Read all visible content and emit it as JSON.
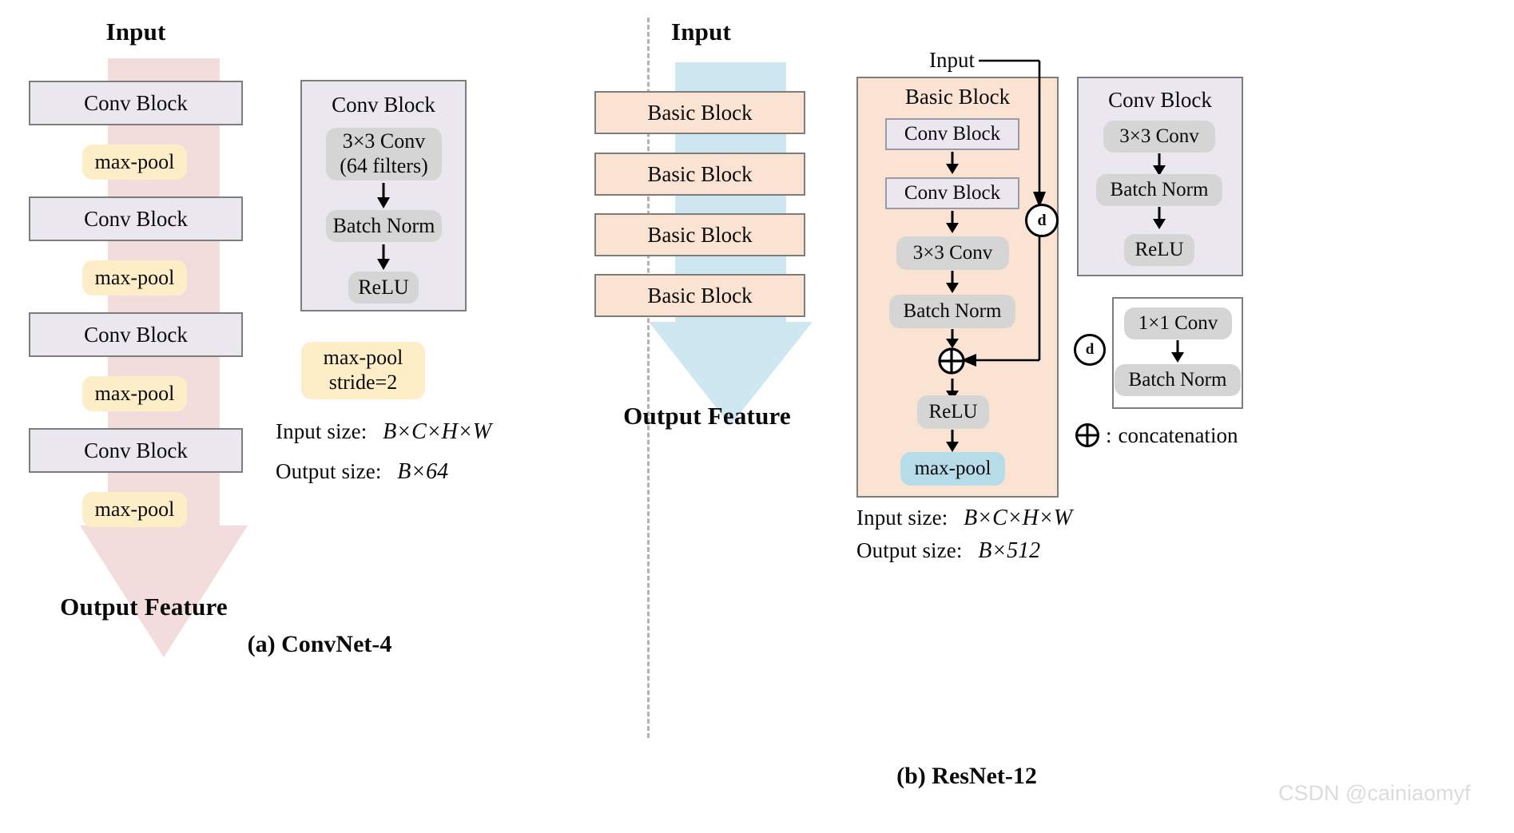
{
  "figure": {
    "watermark": "CSDN @cainiaomyf"
  },
  "panel_a": {
    "caption": "(a) ConvNet-4",
    "input_label": "Input",
    "output_label": "Output Feature",
    "flow_color": "#f2dcdc",
    "stack": [
      {
        "type": "conv-block",
        "label": "Conv Block"
      },
      {
        "type": "max-pool",
        "label": "max-pool"
      },
      {
        "type": "conv-block",
        "label": "Conv Block"
      },
      {
        "type": "max-pool",
        "label": "max-pool"
      },
      {
        "type": "conv-block",
        "label": "Conv Block"
      },
      {
        "type": "max-pool",
        "label": "max-pool"
      },
      {
        "type": "conv-block",
        "label": "Conv Block"
      },
      {
        "type": "max-pool",
        "label": "max-pool"
      }
    ],
    "conv_block_detail": {
      "title": "Conv Block",
      "steps": [
        {
          "label": "3×3  Conv",
          "label2": "(64 filters)"
        },
        {
          "label": "Batch Norm"
        },
        {
          "label": "ReLU"
        }
      ]
    },
    "maxpool_detail": {
      "line1": "max-pool",
      "line2": "stride=2"
    },
    "sizes": {
      "input_label": "Input size:",
      "input_value_parts": [
        "B",
        "×",
        "C",
        "×",
        "H",
        "×",
        "W"
      ],
      "input_value": "B×C×H×W",
      "output_label": "Output size:",
      "output_value": "B×64"
    }
  },
  "panel_b": {
    "caption": "(b) ResNet-12",
    "input_label": "Input",
    "output_label": "Output Feature",
    "flow_color": "#cfe7f0",
    "stack": [
      {
        "type": "basic-block",
        "label": "Basic Block"
      },
      {
        "type": "basic-block",
        "label": "Basic Block"
      },
      {
        "type": "basic-block",
        "label": "Basic Block"
      },
      {
        "type": "basic-block",
        "label": "Basic Block"
      }
    ],
    "basic_block_detail": {
      "skip_input_label": "Input",
      "title": "Basic Block",
      "downsample_symbol": "d",
      "concat_symbol": "⊕",
      "steps": [
        {
          "label": "Conv Block",
          "style": "rect-lav"
        },
        {
          "label": "Conv Block",
          "style": "rect-lav"
        },
        {
          "label": "3×3 Conv",
          "style": "pill-gray"
        },
        {
          "label": "Batch Norm",
          "style": "pill-gray"
        },
        {
          "label": "⊕",
          "style": "circle"
        },
        {
          "label": "ReLU",
          "style": "pill-gray"
        },
        {
          "label": "max-pool",
          "style": "pill-blue"
        }
      ]
    },
    "conv_block_detail": {
      "title": "Conv Block",
      "steps": [
        {
          "label": "3×3 Conv"
        },
        {
          "label": "Batch Norm"
        },
        {
          "label": "ReLU"
        }
      ]
    },
    "downsample_detail": {
      "symbol": "d",
      "colon": ":",
      "steps": [
        {
          "label": "1×1 Conv"
        },
        {
          "label": "Batch Norm"
        }
      ]
    },
    "concat_legend": {
      "symbol": "⊕",
      "colon": ":",
      "text": "concatenation"
    },
    "sizes": {
      "input_label": "Input size:",
      "input_value": "B×C×H×W",
      "output_label": "Output size:",
      "output_value": "B×512"
    }
  }
}
